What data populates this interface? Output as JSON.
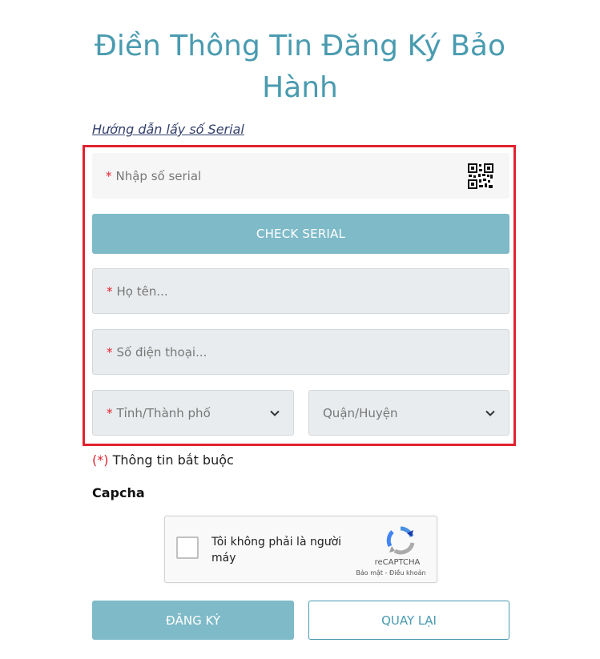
{
  "page": {
    "title": "Điền Thông Tin Đăng Ký Bảo Hành",
    "serial_guide_link": "Hướng dẫn lấy số Serial"
  },
  "form": {
    "required_mark": "*",
    "serial_placeholder": "Nhập số serial",
    "check_serial_label": "CHECK SERIAL",
    "name_placeholder": "Họ tên...",
    "phone_placeholder": "Số điện thoại...",
    "province_placeholder": "Tỉnh/Thành phố",
    "district_placeholder": "Quận/Huyện",
    "required_note_mark": "(*)",
    "required_note_text": " Thông tin bắt buộc"
  },
  "captcha": {
    "label": "Capcha",
    "checkbox_text": "Tôi không phải là người máy",
    "brand": "reCAPTCHA",
    "links": "Bảo mật - Điều khoản"
  },
  "actions": {
    "register_label": "ĐĂNG KÝ",
    "back_label": "QUAY LẠI"
  },
  "colors": {
    "accent": "#4a9bb0",
    "button": "#7fbac8",
    "highlight": "#e0222f",
    "link": "#33406b"
  },
  "icons": {
    "qr": "qr-code-icon",
    "dropdown": "chevron-down-icon",
    "recaptcha": "recaptcha-logo-icon"
  }
}
